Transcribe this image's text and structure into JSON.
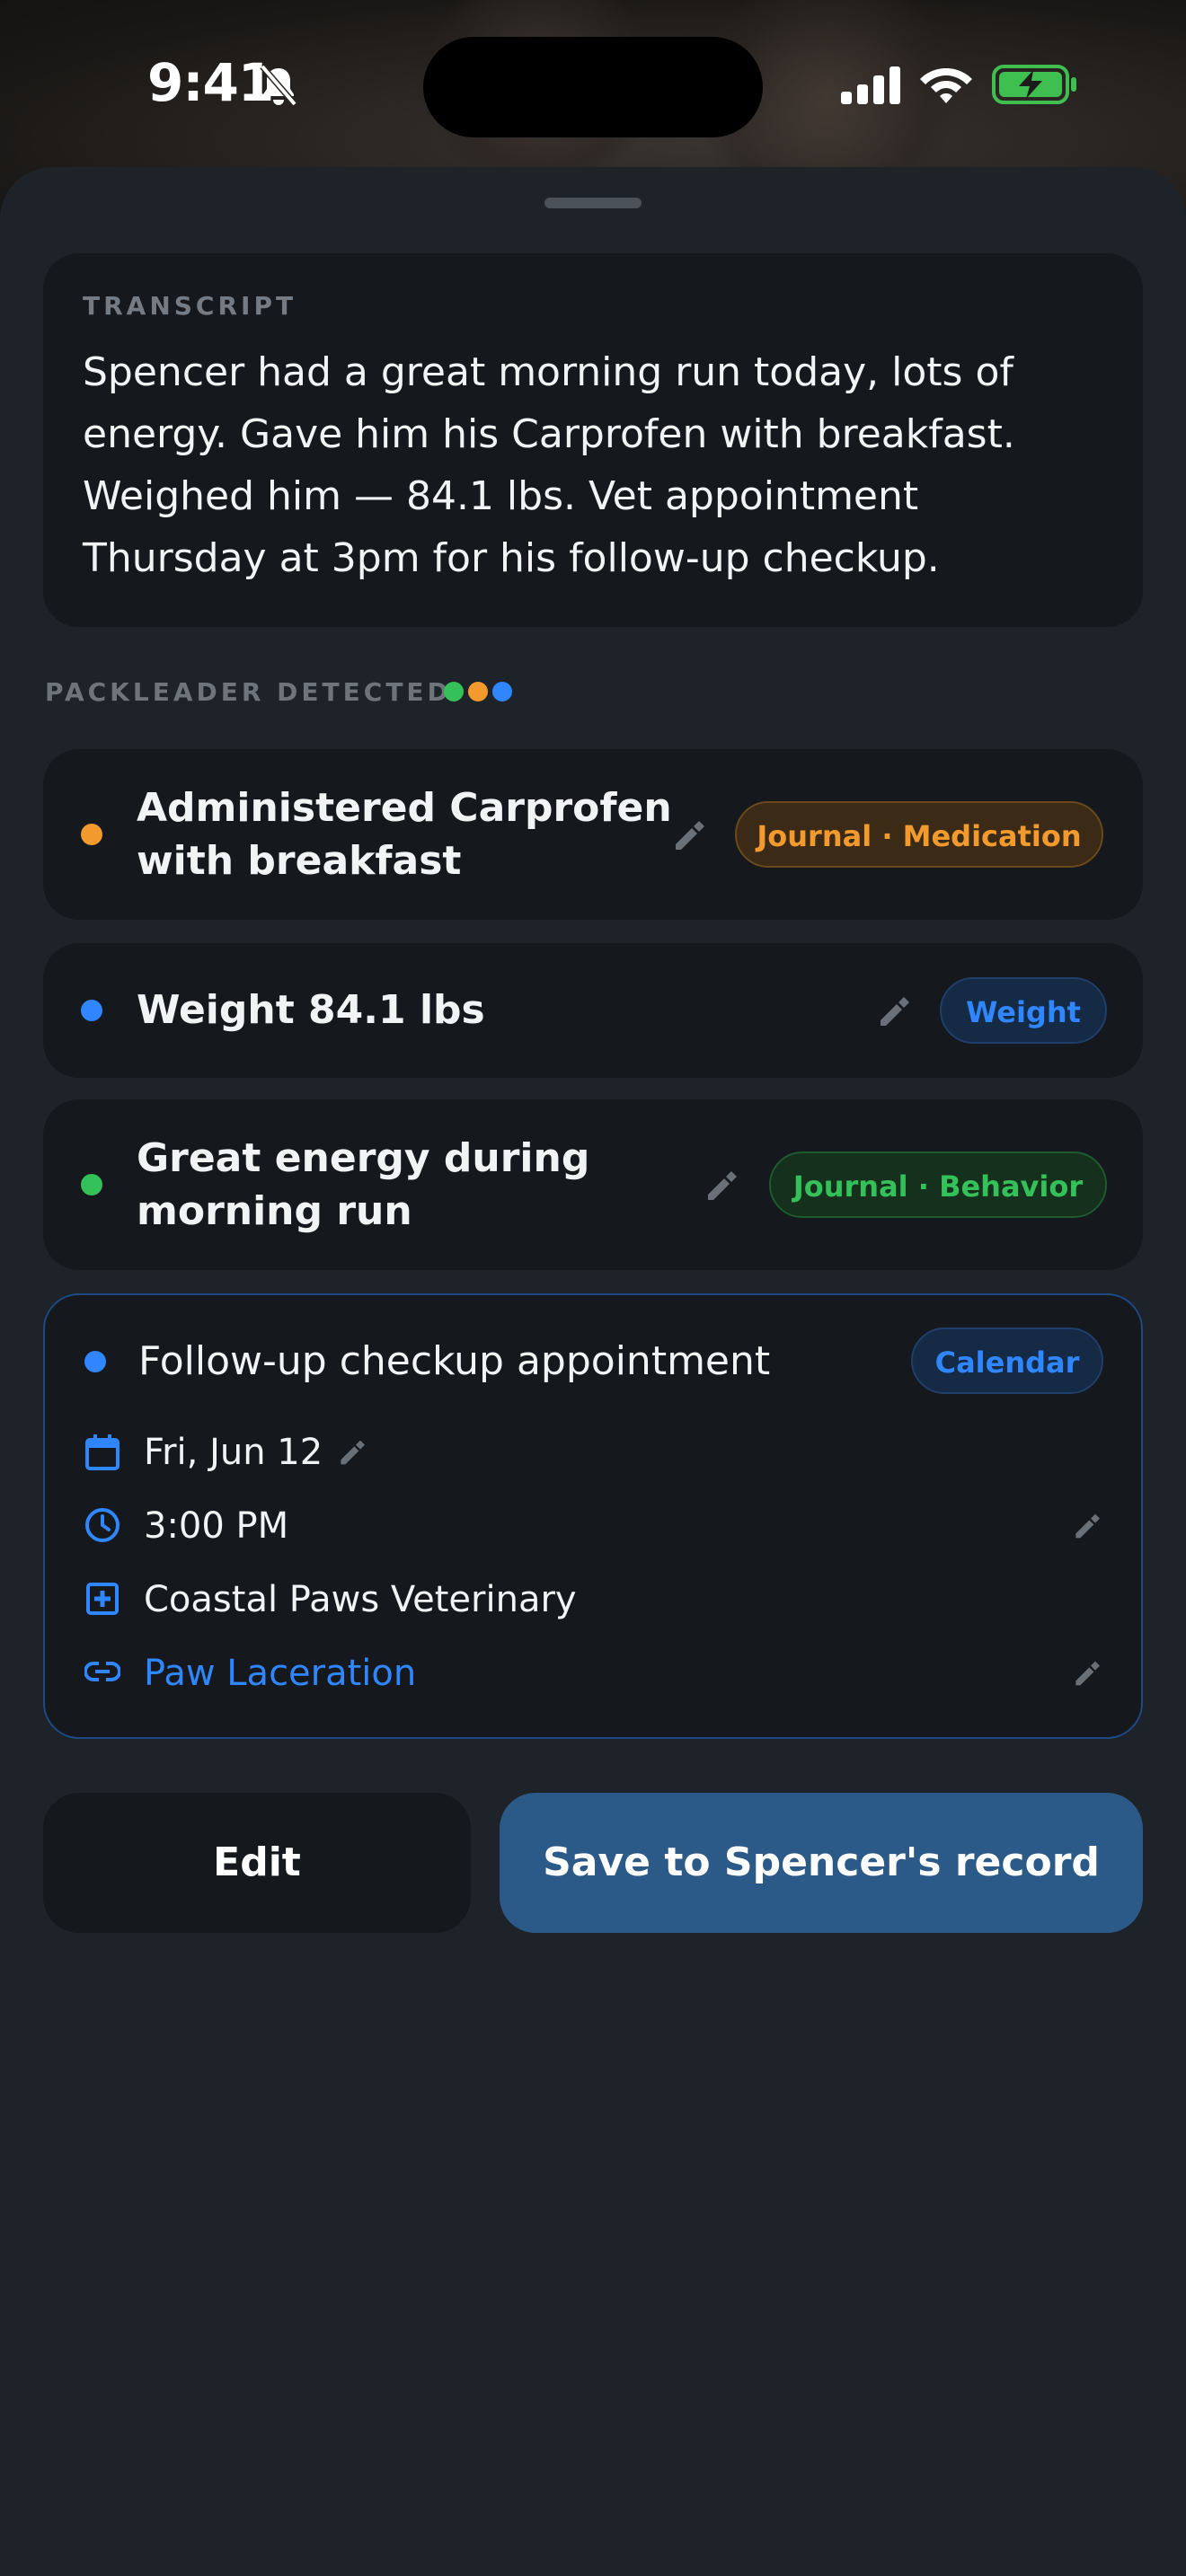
{
  "status_bar": {
    "time": "9:41",
    "icons": [
      "silent-bell-icon",
      "signal-icon",
      "wifi-icon",
      "battery-charging-icon"
    ]
  },
  "transcript": {
    "label": "TRANSCRIPT",
    "text": "Spencer had a great morning run today, lots of energy. Gave him his Carprofen with breakfast. Weighed him — 84.1 lbs. Vet appointment Thursday at 3pm for his follow-up checkup."
  },
  "detected": {
    "label": "PACKLEADER DETECTED",
    "dot_colors": [
      "#35c15a",
      "#f29a2e",
      "#2f86ff"
    ]
  },
  "items": [
    {
      "line1": "Administered Carprofen",
      "line2": "with breakfast",
      "chip": "Journal · Medication",
      "color": "#f29a2e"
    },
    {
      "line1": "Weight 84.1 lbs",
      "chip": "Weight",
      "color": "#2f86ff"
    },
    {
      "line1": "Great energy during",
      "line2": "morning run",
      "chip": "Journal · Behavior",
      "color": "#35c15a"
    }
  ],
  "appointment": {
    "title": "Follow-up checkup appointment",
    "chip": "Calendar",
    "date": "Fri, Jun 12",
    "time": "3:00 PM",
    "location": "Coastal Paws Veterinary",
    "link": "Paw Laceration",
    "accent": "#2f86ff"
  },
  "actions": {
    "edit": "Edit",
    "save": "Save to Spencer's record"
  }
}
